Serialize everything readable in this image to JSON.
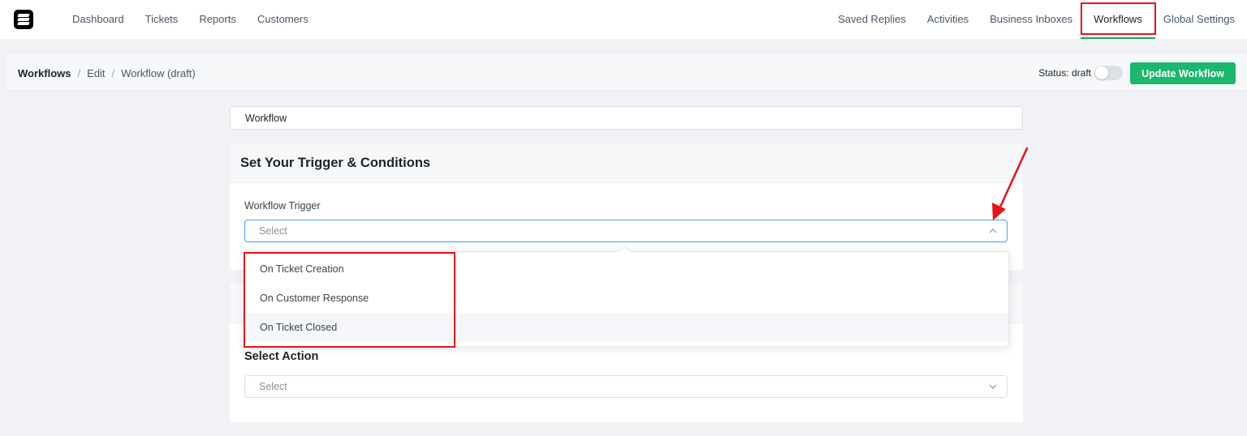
{
  "nav": {
    "left": [
      "Dashboard",
      "Tickets",
      "Reports",
      "Customers"
    ],
    "right": [
      "Saved Replies",
      "Activities",
      "Business Inboxes",
      "Workflows",
      "Global Settings"
    ],
    "active": "Workflows"
  },
  "breadcrumb": {
    "root": "Workflows",
    "sep": "/",
    "edit": "Edit",
    "current": "Workflow (draft)"
  },
  "status": {
    "label": "Status: draft",
    "toggle_on": false
  },
  "update_button": "Update Workflow",
  "workflow_name": "Workflow",
  "trigger_section": {
    "title": "Set Your Trigger & Conditions",
    "field_label": "Workflow Trigger",
    "placeholder": "Select"
  },
  "trigger_options": [
    "On Ticket Creation",
    "On Customer Response",
    "On Ticket Closed"
  ],
  "action_section": {
    "title": "Select Action",
    "placeholder": "Select"
  },
  "colors": {
    "accent_green": "#1bb76e",
    "annotation_red": "#e8121c",
    "focus_blue": "#409eff"
  },
  "icons": [
    "logo-icon",
    "chevron-up-icon",
    "chevron-down-icon",
    "annotation-arrow-icon"
  ]
}
